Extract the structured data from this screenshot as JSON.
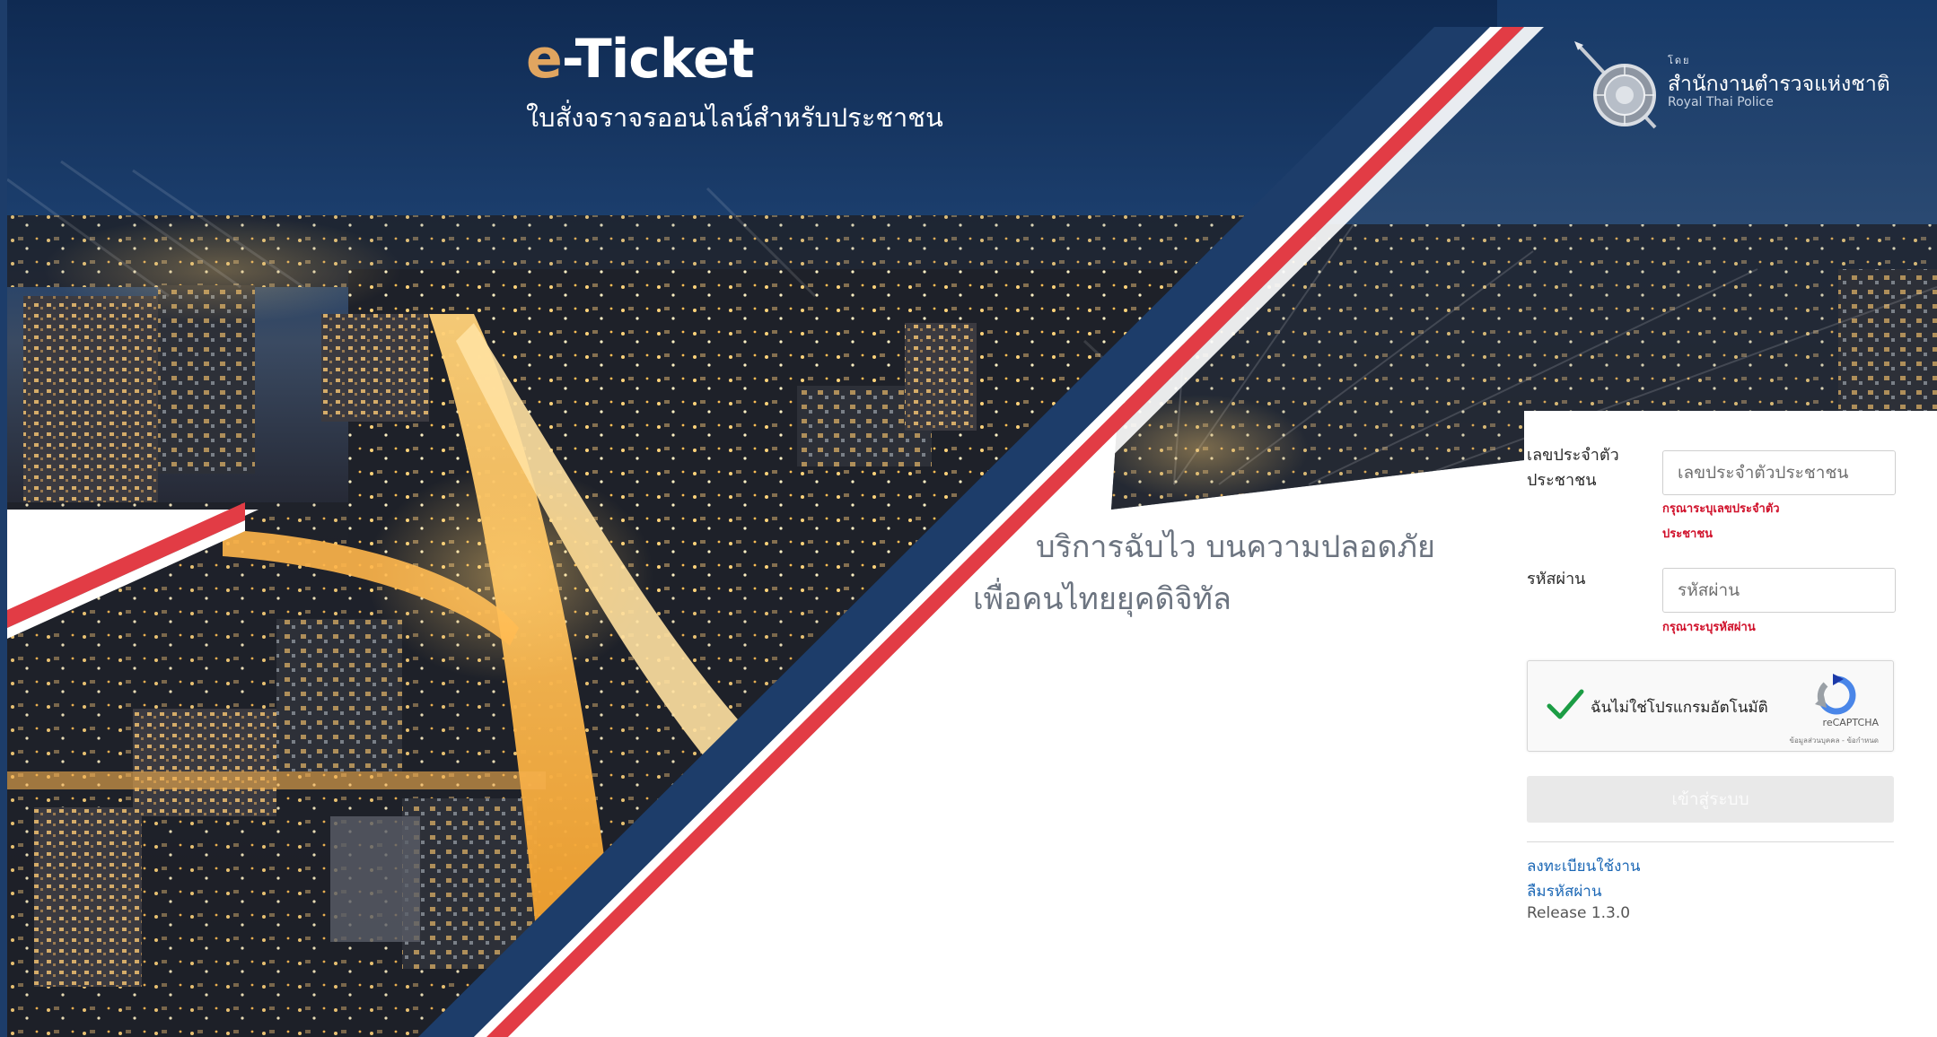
{
  "brand": {
    "title_accent": "e",
    "title_rest": "-Ticket",
    "subtitle": "ใบสั่งจราจรออนไลน์สำหรับประชาชน"
  },
  "police": {
    "by": "โดย",
    "name": "สำนักงานตำรวจแห่งชาติ",
    "name_en": "Royal Thai Police",
    "emblem_icon": "police-emblem-icon"
  },
  "tagline": {
    "line1": "บริการฉับไว บนความปลอดภัย",
    "line2": "เพื่อคนไทยยุคดิจิทัล"
  },
  "login": {
    "id_label_line1": "เลขประจำตัว",
    "id_label_line2": "ประชาชน",
    "id_placeholder": "เลขประจำตัวประชาชน",
    "id_error_line1": "กรุณาระบุเลขประจำตัว",
    "id_error_line2": "ประชาชน",
    "password_label": "รหัสผ่าน",
    "password_placeholder": "รหัสผ่าน",
    "password_error": "กรุณาระบุรหัสผ่าน",
    "captcha_label": "ฉันไม่ใช่โปรแกรมอัตโนมัติ",
    "captcha_brand": "reCAPTCHA",
    "captcha_terms": "ข้อมูลส่วนบุคคล - ข้อกำหนด",
    "submit_label": "เข้าสู่ระบบ",
    "register_link": "ลงทะเบียนใช้งาน",
    "forgot_link": "ลืมรหัสผ่าน",
    "release": "Release 1.3.0"
  },
  "colors": {
    "navy": "#1d3d6a",
    "red": "#e23c45",
    "accent": "#e0a560",
    "link": "#1b67b5",
    "error": "#d0102a"
  }
}
